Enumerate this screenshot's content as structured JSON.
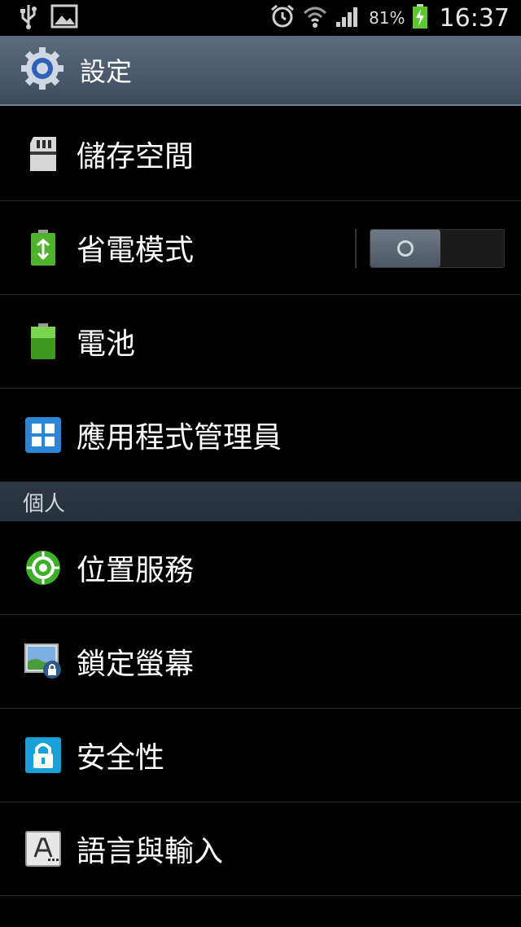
{
  "status_bar": {
    "battery_percent": "81%",
    "time": "16:37",
    "icons": [
      "usb-icon",
      "gallery-icon",
      "alarm-icon",
      "wifi-icon",
      "signal-icon",
      "battery-charging-icon"
    ]
  },
  "action_bar": {
    "title": "設定",
    "icon": "settings-gear-icon"
  },
  "rows_top": [
    {
      "label": "儲存空間",
      "icon": "sd-card-icon"
    },
    {
      "label": "省電模式",
      "icon": "power-saving-icon",
      "toggle": false
    },
    {
      "label": "電池",
      "icon": "battery-icon"
    },
    {
      "label": "應用程式管理員",
      "icon": "app-manager-icon"
    }
  ],
  "section_personal": {
    "label": "個人"
  },
  "rows_personal": [
    {
      "label": "位置服務",
      "icon": "location-icon"
    },
    {
      "label": "鎖定螢幕",
      "icon": "lock-screen-icon"
    },
    {
      "label": "安全性",
      "icon": "security-lock-icon"
    },
    {
      "label": "語言與輸入",
      "icon": "language-input-icon"
    }
  ],
  "colors": {
    "action_bar": "#4a5a6d",
    "section_header": "#2b3440",
    "location_green": "#3fae2a",
    "lock_blue": "#1aa0d8"
  }
}
